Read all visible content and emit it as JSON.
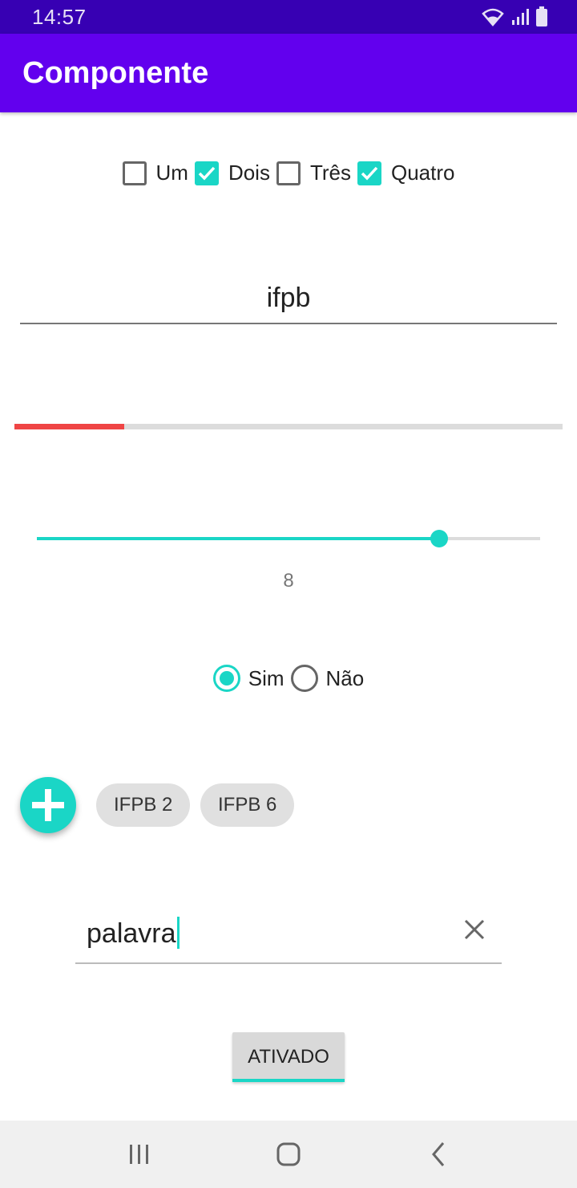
{
  "status_bar": {
    "time": "14:57",
    "icons": [
      "wifi-icon",
      "signal-icon",
      "battery-icon"
    ]
  },
  "app_bar": {
    "title": "Componente"
  },
  "checkboxes": [
    {
      "label": "Um",
      "checked": false
    },
    {
      "label": "Dois",
      "checked": true
    },
    {
      "label": "Três",
      "checked": false
    },
    {
      "label": "Quatro",
      "checked": true
    }
  ],
  "text_field": {
    "value": "ifpb"
  },
  "progress": {
    "value": 0.2
  },
  "slider": {
    "value": 8,
    "max": 10,
    "value_label": "8"
  },
  "radio_group": {
    "options": [
      {
        "label": "Sim",
        "selected": true
      },
      {
        "label": "Não",
        "selected": false
      }
    ]
  },
  "fab": {
    "icon": "plus-icon"
  },
  "chips": [
    {
      "label": "IFPB 2"
    },
    {
      "label": "IFPB 6"
    }
  ],
  "search": {
    "value": "palavra",
    "clear_icon": "close-icon"
  },
  "toggle": {
    "label": "ATIVADO",
    "checked": true
  },
  "colors": {
    "primary": "#6200ee",
    "primary_dark": "#3700b3",
    "accent": "#1ad6c6",
    "progress": "#ef4545"
  },
  "nav_bar": {
    "icons": [
      "recent-apps-icon",
      "home-icon",
      "back-icon"
    ]
  }
}
